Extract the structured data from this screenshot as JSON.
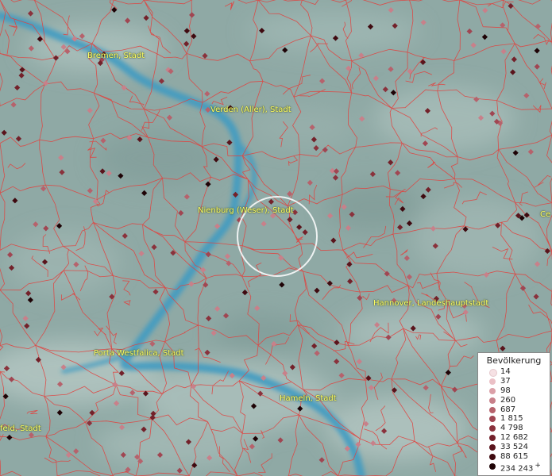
{
  "map": {
    "cities": [
      {
        "label": "Bremen, Stadt"
      },
      {
        "label": "Verden (Aller), Stadt"
      },
      {
        "label": "Nienburg (Weser), Stadt"
      },
      {
        "label": "Hannover, Landeshauptstadt"
      },
      {
        "label": "Porta Westfalica, Stadt"
      },
      {
        "label": "Hameln, Stadt"
      },
      {
        "label": "feld, Stadt"
      },
      {
        "label": "Ce"
      }
    ],
    "colors": {
      "background": "#8fa9a5",
      "river": "#3f9bc2",
      "boundaries": "#e0433f",
      "city_label": "#ffff66",
      "selection_circle": "#ffffff"
    }
  },
  "legend": {
    "title": "Bevölkerung",
    "items": [
      {
        "value": "14",
        "color": "#f6e1e4"
      },
      {
        "value": "37",
        "color": "#ebc0c6"
      },
      {
        "value": "98",
        "color": "#dba0a8"
      },
      {
        "value": "260",
        "color": "#c8808a"
      },
      {
        "value": "687",
        "color": "#b6626c"
      },
      {
        "value": "1 815",
        "color": "#a04652"
      },
      {
        "value": "4 798",
        "color": "#8a323c"
      },
      {
        "value": "12 682",
        "color": "#73212a"
      },
      {
        "value": "33 524",
        "color": "#5a141c"
      },
      {
        "value": "88 615",
        "color": "#3f0a10"
      },
      {
        "value": "234 243",
        "color": "#1e0306"
      }
    ],
    "plus": "+"
  }
}
